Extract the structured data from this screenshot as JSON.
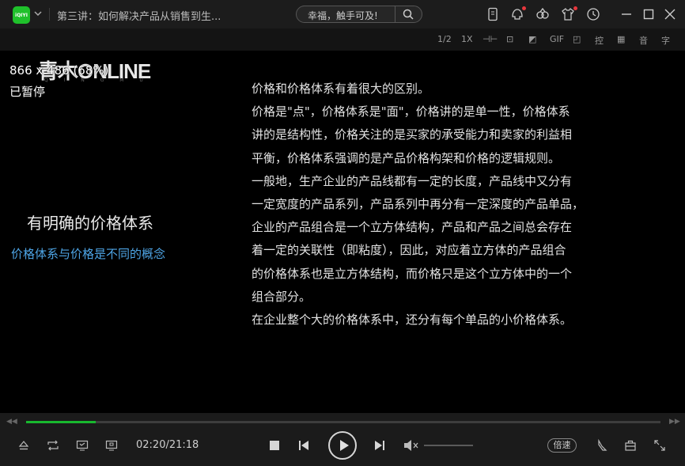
{
  "app": {
    "logo_text": "iQIYI",
    "window_title": "第三讲：如何解决产品从销售到生...",
    "search_placeholder": "幸福，触手可及!",
    "accent_color": "#1fc12b",
    "title_icons": [
      "phone-icon",
      "skin-icon",
      "vip-icon",
      "shirt-icon",
      "history-icon",
      "minimize-icon",
      "maximize-icon",
      "close-icon"
    ]
  },
  "toolbar": {
    "items": [
      "1/2",
      "1X",
      "⊣⊢",
      "⊡",
      "◩",
      "GIF",
      "◰",
      "控",
      "▦",
      "音",
      "字"
    ]
  },
  "video": {
    "brand": "青木ONLINE",
    "brand_sub": "Q I N G M U",
    "resolution_text": "866 x 486 (68%)",
    "status_text": "已暂停",
    "heading": "有明确的价格体系",
    "subheading": "价格体系与价格是不同的概念",
    "subheading_color": "#4ea5e6",
    "body_lines": [
      "价格和价格体系有着很大的区别。",
      "价格是\"点\"，价格体系是\"面\"，价格讲的是单一性，价格体系",
      "讲的是结构性，价格关注的是买家的承受能力和卖家的利益相",
      "平衡，价格体系强调的是产品价格构架和价格的逻辑规则。",
      "一般地，生产企业的产品线都有一定的长度，产品线中又分有",
      "一定宽度的产品系列，产品系列中再分有一定深度的产品单品，",
      "企业的产品组合是一个立方体结构，产品和产品之间总会存在",
      "着一定的关联性（即粘度），因此，对应着立方体的产品组合",
      "的价格体系也是立方体结构，而价格只是这个立方体中的一个",
      "组合部分。",
      "在企业整个大的价格体系中，还分有每个单品的小价格体系。"
    ]
  },
  "controls": {
    "time_display": "02:20/21:18",
    "progress_fraction": 0.11,
    "progress_color": "#18b82e",
    "speed_label": "倍速",
    "volume_muted": true
  }
}
